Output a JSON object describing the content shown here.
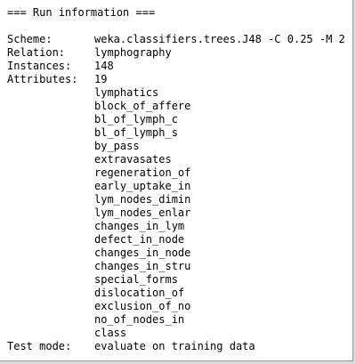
{
  "run_info": {
    "header": "=== Run information ===",
    "scheme_label": "Scheme:",
    "scheme_value": "weka.classifiers.trees.J48 -C 0.25 -M 2",
    "relation_label": "Relation:",
    "relation_value": "lymphography",
    "instances_label": "Instances:",
    "instances_value": "148",
    "attributes_label": "Attributes:",
    "attributes_count": "19",
    "attributes": [
      "lymphatics",
      "block_of_affere",
      "bl_of_lymph_c",
      "bl_of_lymph_s",
      "by_pass",
      "extravasates",
      "regeneration_of",
      "early_uptake_in",
      "lym_nodes_dimin",
      "lym_nodes_enlar",
      "changes_in_lym",
      "defect_in_node",
      "changes_in_node",
      "changes_in_stru",
      "special_forms",
      "dislocation_of",
      "exclusion_of_no",
      "no_of_nodes_in",
      "class"
    ],
    "test_mode_label": "Test mode:",
    "test_mode_value": "evaluate on training data"
  }
}
